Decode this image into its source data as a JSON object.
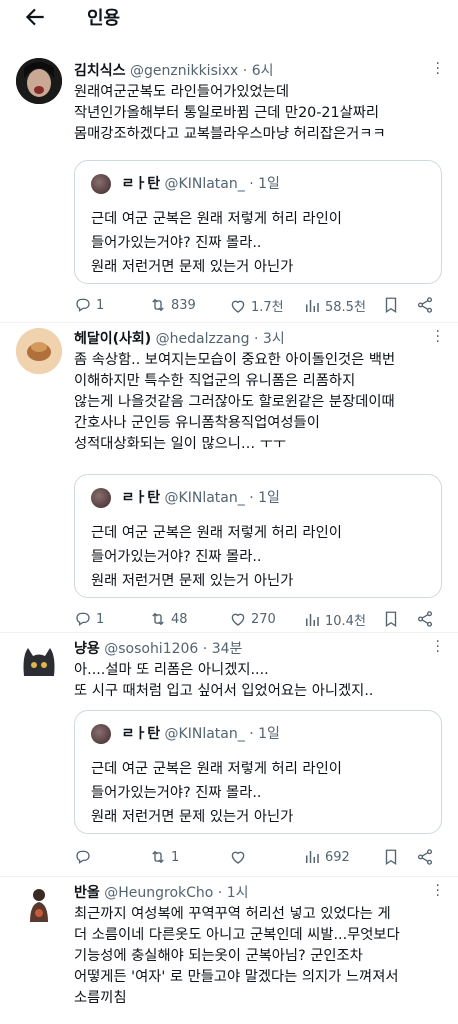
{
  "header": {
    "title": "인용"
  },
  "quoted": {
    "name": "ㄹㅏ탄",
    "handle": "@KINlatan_",
    "time": "1일",
    "text": "근데 여군 군복은 원래 저렇게 허리 라인이\n들어가있는거야? 진짜 몰라..\n원래 저런거면 문제 있는거 아닌가"
  },
  "tweets": [
    {
      "name": "김치식스",
      "handle": "@genznikkisixx",
      "time": "6시",
      "text": "원래여군군복도 라인들어가있었는데\n작년인가올해부터 통일로바뀜 근데 만20-21살짜리\n몸매강조하겠다고 교복블라우스마냥 허리잡은거ㅋㅋ",
      "replies": "1",
      "retweets": "839",
      "likes": "1.7천",
      "views": "58.5천"
    },
    {
      "name": "헤달이(사회)",
      "handle": "@hedalzzang",
      "time": "3시",
      "text": "좀 속상함.. 보여지는모습이 중요한 아이돌인것은 백번\n이해하지만 특수한 직업군의 유니폼은 리폼하지\n않는게 나을것같음 그러잖아도 할로윈같은 분장데이때\n간호사나 군인등 유니폼착용직업여성들이\n성적대상화되는 일이 많으니… ㅜㅜ",
      "replies": "1",
      "retweets": "48",
      "likes": "270",
      "views": "10.4천"
    },
    {
      "name": "냥용",
      "handle": "@sosohi1206",
      "time": "34분",
      "text": "아....설마 또 리폼은 아니겠지....\n또 시구 때처럼 입고 싶어서 입었어요는 아니겠지..",
      "replies": "",
      "retweets": "1",
      "likes": "",
      "views": "692"
    },
    {
      "name": "반올",
      "handle": "@HeungrokCho",
      "time": "1시",
      "text": "최근까지 여성복에 꾸역꾸역 허리선 넣고 있었다는 게\n더 소름이네 다른옷도 아니고 군복인데 씨발...무엇보다\n기능성에 충실해야 되는옷이 군복아님? 군인조차\n어떻게든 '여자' 로 만들고야 말겠다는 의지가 느껴져서\n소름끼침"
    }
  ],
  "icons": {
    "back": "arrow-left-icon",
    "reply": "reply-icon",
    "retweet": "retweet-icon",
    "like": "heart-icon",
    "views": "views-icon",
    "bookmark": "bookmark-icon",
    "share": "share-icon"
  }
}
